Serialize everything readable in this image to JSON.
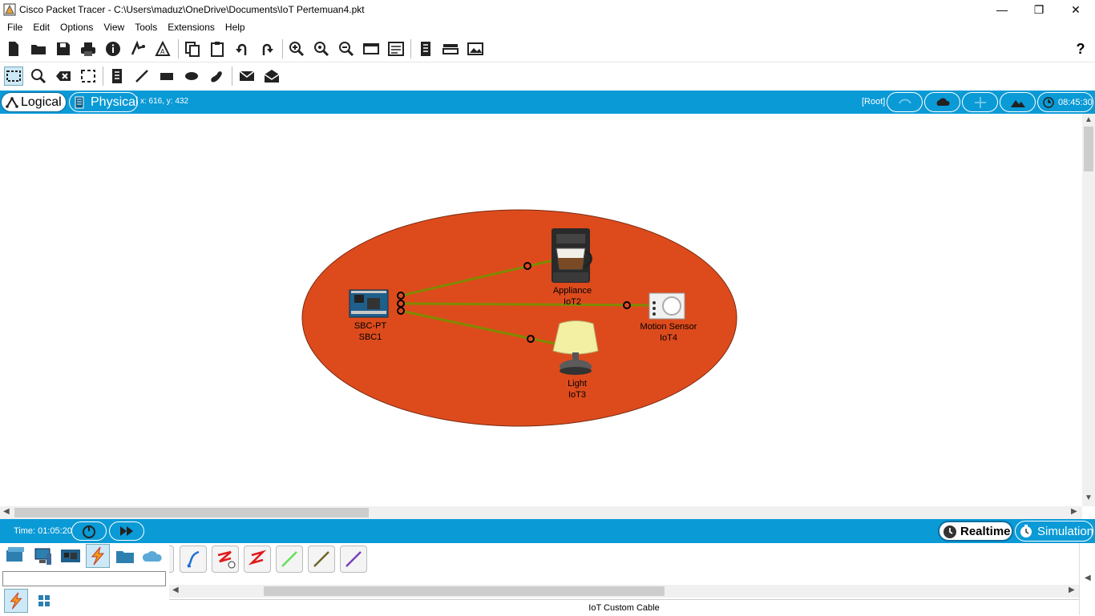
{
  "window": {
    "title": "Cisco Packet Tracer - C:\\Users\\maduz\\OneDrive\\Documents\\IoT Pertemuan4.pkt",
    "minimize": "—",
    "maximize": "❐",
    "close": "✕"
  },
  "menu": [
    "File",
    "Edit",
    "Options",
    "View",
    "Tools",
    "Extensions",
    "Help"
  ],
  "toolbar_main": {
    "icons": [
      "new-icon",
      "open-icon",
      "save-icon",
      "print-icon",
      "info-icon",
      "network-wizard-icon",
      "activity-wizard-icon",
      "copy-icon",
      "paste-icon",
      "undo-icon",
      "redo-icon",
      "zoom-in-icon",
      "zoom-reset-icon",
      "zoom-out-icon",
      "drawing-palette-icon",
      "custom-device-icon",
      "cluster-icon",
      "pdu-icon",
      "image-icon"
    ],
    "help": "?"
  },
  "toolbar_edit": {
    "icons": [
      "select-icon",
      "inspect-icon",
      "delete-icon",
      "resize-icon",
      "note-icon",
      "line-icon",
      "rectangle-icon",
      "ellipse-icon",
      "freeform-icon",
      "simple-pdu-icon",
      "complex-pdu-icon"
    ]
  },
  "view_bar": {
    "logical_tab": "Logical",
    "physical_tab": "Physical",
    "coords": "x: 616, y: 432",
    "root": "[Root]",
    "clock": "08:45:30"
  },
  "canvas": {
    "zone_color": "#dd4b1d",
    "link_color": "#7f8a00",
    "devices": [
      {
        "name": "SBC-PT",
        "label": "SBC1"
      },
      {
        "name": "Appliance",
        "label": "IoT2"
      },
      {
        "name": "Motion Sensor",
        "label": "IoT4"
      },
      {
        "name": "Light",
        "label": "IoT3"
      }
    ]
  },
  "status": {
    "time": "Time: 01:05:20",
    "realtime": "Realtime",
    "simulation": "Simulation"
  },
  "device_panel": {
    "categories": [
      "network-devices-icon",
      "end-devices-icon",
      "components-icon",
      "connections-icon",
      "miscellaneous-icon",
      "multiuser-icon"
    ],
    "subcategories": [
      "connections-icon",
      "grid-icon"
    ],
    "cables": [
      "console-cable",
      "straight-through-cable",
      "crossover-cable",
      "fiber-cable",
      "phone-cable",
      "coaxial-cable",
      "iot-custom-cable"
    ],
    "selected_cable_label": "IoT Custom Cable"
  },
  "colors": {
    "accent": "#0a9ad6",
    "zone": "#dd4b1d"
  }
}
